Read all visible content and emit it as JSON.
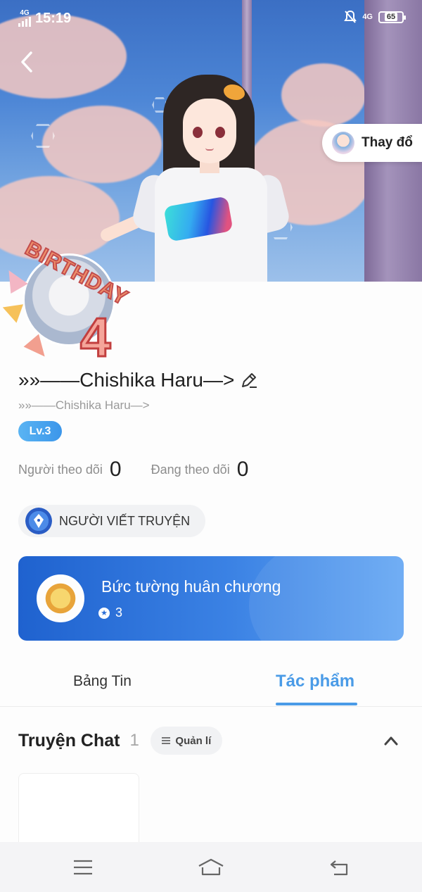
{
  "status_bar": {
    "network_left": "4G",
    "time": "15:19",
    "network_right": "4G",
    "battery": "65"
  },
  "hero": {
    "change_button_label": "Thay đổ",
    "avatar_frame_number": "4",
    "avatar_frame_text": "BIRTHDAY"
  },
  "profile": {
    "name": "»»——Chishika Haru—>",
    "sub_name": "»»——Chishika Haru—>",
    "level": "Lv.3",
    "followers_label": "Người theo dõi",
    "followers_count": "0",
    "following_label": "Đang theo dõi",
    "following_count": "0",
    "badge_label": "NGƯỜI VIẾT TRUYỆN"
  },
  "medal_wall": {
    "title": "Bức tường huân chương",
    "count": "3"
  },
  "tabs": [
    {
      "label": "Bảng Tin",
      "active": false
    },
    {
      "label": "Tác phẩm",
      "active": true
    }
  ],
  "section": {
    "title": "Truyện Chat",
    "count": "1",
    "manage_label": "Quản lí"
  },
  "icons": {
    "back": "back-icon",
    "edit": "pencil-icon",
    "menu": "menu-icon",
    "home": "home-icon",
    "return": "return-icon",
    "collapse": "chevron-up-icon"
  },
  "colors": {
    "accent": "#4a9be7",
    "medal_card": "#2b6fd6",
    "level_badge": "#4aa6ef"
  }
}
